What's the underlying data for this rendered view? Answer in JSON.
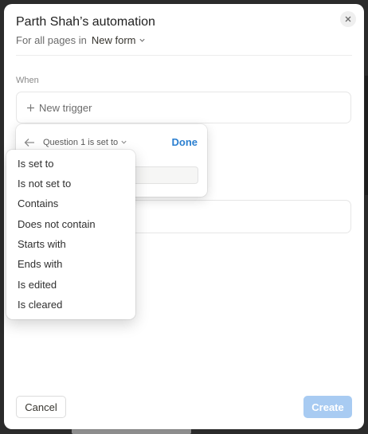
{
  "modal": {
    "title": "Parth Shah’s automation",
    "scope_prefix": "For all pages in",
    "scope_form": "New form"
  },
  "when": {
    "label": "When",
    "new_trigger": "New trigger"
  },
  "popover": {
    "property_label": "Question 1 is set to",
    "done_label": "Done"
  },
  "condition_menu": {
    "items": [
      "Is set to",
      "Is not set to",
      "Contains",
      "Does not contain",
      "Starts with",
      "Ends with",
      "Is edited",
      "Is cleared"
    ]
  },
  "footer": {
    "cancel_label": "Cancel",
    "create_label": "Create"
  },
  "colors": {
    "accent": "#2b7fd0",
    "create_disabled": "#a8cbf2"
  },
  "icons": [
    "close-icon",
    "chevron-down-icon",
    "plus-icon",
    "back-arrow-icon"
  ]
}
